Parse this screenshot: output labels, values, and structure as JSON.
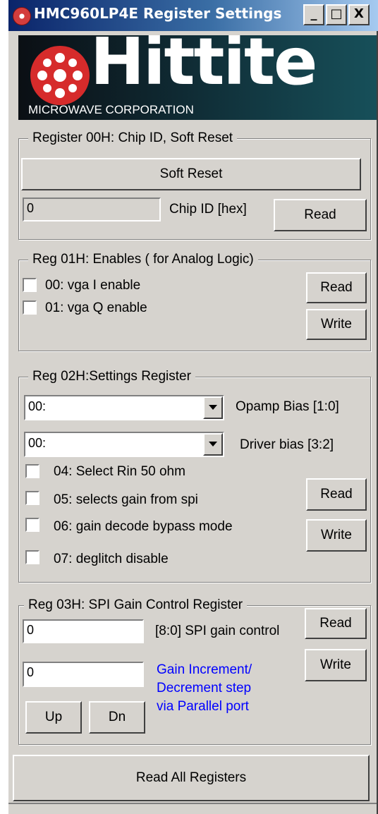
{
  "window": {
    "title": "HMC960LP4E Register Settings"
  },
  "titlebar": {
    "minimize": "_",
    "maximize": "□",
    "close": "X"
  },
  "logo": {
    "name": "Hittite",
    "subtitle": "MICROWAVE CORPORATION"
  },
  "reg00": {
    "title": "Register 00H: Chip ID, Soft Reset",
    "soft_reset_label": "Soft Reset",
    "chip_id_value": "0",
    "chip_id_label": "Chip ID [hex]",
    "read_label": "Read"
  },
  "reg01": {
    "title": "Reg 01H: Enables ( for Analog Logic)",
    "checks": [
      "00: vga I enable",
      "01: vga Q enable"
    ],
    "read_label": "Read",
    "write_label": "Write"
  },
  "reg02": {
    "title": "Reg 02H:Settings Register",
    "opamp_bias_value": "00:",
    "opamp_bias_label": "Opamp Bias [1:0]",
    "driver_bias_value": "00:",
    "driver_bias_label": "Driver bias [3:2]",
    "checks": [
      "04:  Select Rin 50 ohm",
      "05: selects gain from spi",
      "06: gain decode bypass mode",
      "07: deglitch disable"
    ],
    "read_label": "Read",
    "write_label": "Write"
  },
  "reg03": {
    "title": "Reg 03H: SPI Gain Control Register",
    "gain_value": "0",
    "gain_label": "[8:0] SPI gain control",
    "step_value": "0",
    "step_label": [
      "Gain Increment/",
      "Decrement step",
      "via Parallel port"
    ],
    "read_label": "Read",
    "write_label": "Write",
    "up_label": "Up",
    "dn_label": "Dn"
  },
  "read_all_label": "Read All Registers",
  "colors": {
    "window_bg": "#d6d3ce",
    "title_start": "#0a246a",
    "title_end": "#a6caf0",
    "link_blue": "#0000ff"
  }
}
